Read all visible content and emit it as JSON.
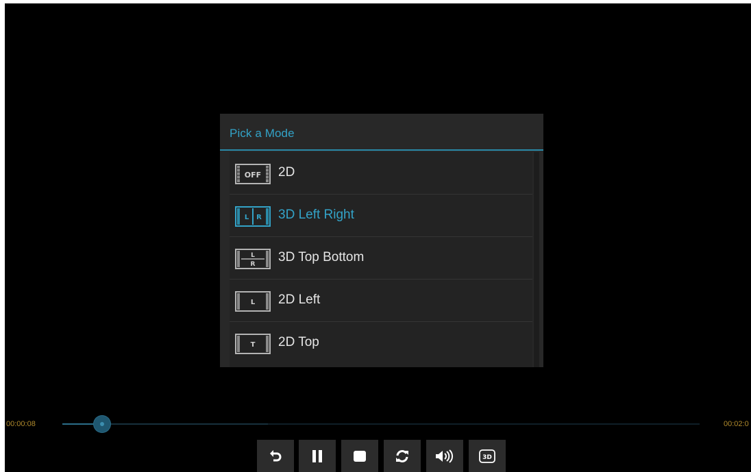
{
  "dialog": {
    "title": "Pick a Mode",
    "items": [
      {
        "label": "2D",
        "icon": "off-mode-icon",
        "icon_text": "OFF",
        "selected": false
      },
      {
        "label": "3D Left Right",
        "icon": "left-right-mode-icon",
        "icon_text": "L R",
        "selected": true
      },
      {
        "label": "3D Top Bottom",
        "icon": "top-bottom-mode-icon",
        "icon_text": "L R",
        "selected": false
      },
      {
        "label": "2D Left",
        "icon": "left-mode-icon",
        "icon_text": "L",
        "selected": false
      },
      {
        "label": "2D Top",
        "icon": "top-mode-icon",
        "icon_text": "T",
        "selected": false
      }
    ]
  },
  "player": {
    "current_time": "00:00:08",
    "total_time": "00:02:0",
    "progress_fraction": 0.06,
    "buttons": [
      {
        "name": "back-button",
        "icon": "back-arrow-icon"
      },
      {
        "name": "pause-button",
        "icon": "pause-icon"
      },
      {
        "name": "stop-button",
        "icon": "stop-icon"
      },
      {
        "name": "repeat-button",
        "icon": "refresh-icon"
      },
      {
        "name": "volume-button",
        "icon": "volume-icon"
      },
      {
        "name": "3d-mode-button",
        "icon": "3d-icon"
      }
    ],
    "three_d_badge": "3D"
  },
  "colors": {
    "accent": "#33a3c8",
    "time_text": "#b08a2c",
    "dialog_bg": "#282828"
  }
}
